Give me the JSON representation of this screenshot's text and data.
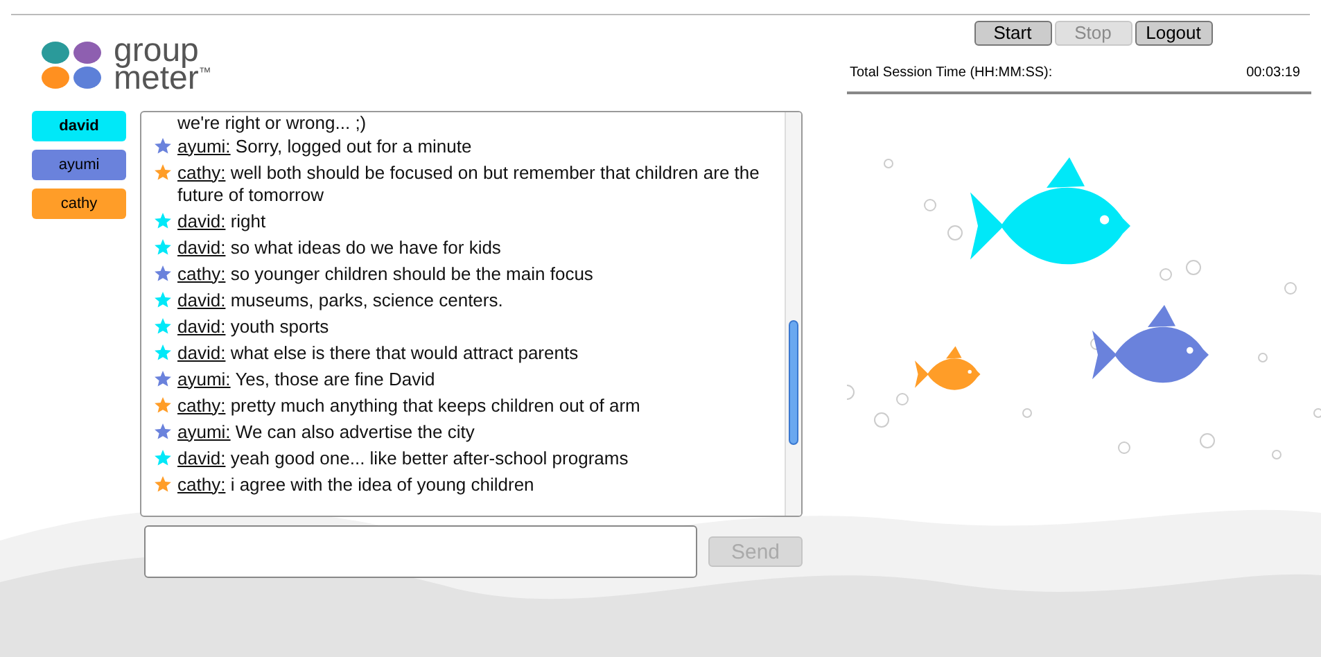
{
  "logo": {
    "line1": "group",
    "line2": "meter",
    "mark": "™"
  },
  "users": [
    {
      "name": "david",
      "color": "#00e8f8",
      "selected": true
    },
    {
      "name": "ayumi",
      "color": "#6a82dc",
      "selected": false
    },
    {
      "name": "cathy",
      "color": "#ff9d28",
      "selected": false
    }
  ],
  "messages": [
    {
      "kind": "continuation",
      "text": "we're right or wrong... ;)"
    },
    {
      "kind": "message",
      "user": "ayumi:",
      "color": "#6a82dc",
      "text": "Sorry, logged out for a minute"
    },
    {
      "kind": "message",
      "user": "cathy:",
      "color": "#ff9d28",
      "text": "well both should be focused on but remember that children are the future of tomorrow"
    },
    {
      "kind": "message",
      "user": "david:",
      "color": "#00e8f8",
      "text": "right"
    },
    {
      "kind": "message",
      "user": "david:",
      "color": "#00e8f8",
      "text": "so what ideas do we have for kids"
    },
    {
      "kind": "message",
      "user": "cathy:",
      "color": "#6a82dc",
      "text": "so younger children should be the main focus"
    },
    {
      "kind": "message",
      "user": "david:",
      "color": "#00e8f8",
      "text": "museums, parks, science centers."
    },
    {
      "kind": "message",
      "user": "david:",
      "color": "#00e8f8",
      "text": "youth sports"
    },
    {
      "kind": "message",
      "user": "david:",
      "color": "#00e8f8",
      "text": "what else is there that would attract parents"
    },
    {
      "kind": "message",
      "user": "ayumi:",
      "color": "#6a82dc",
      "text": "Yes, those are fine David"
    },
    {
      "kind": "message",
      "user": "cathy:",
      "color": "#ff9d28",
      "text": "pretty much anything that keeps children out of arm"
    },
    {
      "kind": "message",
      "user": "ayumi:",
      "color": "#6a82dc",
      "text": "We can also advertise the city"
    },
    {
      "kind": "message",
      "user": "david:",
      "color": "#00e8f8",
      "text": "yeah good one... like better after-school programs"
    },
    {
      "kind": "message",
      "user": "cathy:",
      "color": "#ff9d28",
      "text": "i agree with the idea of young children"
    }
  ],
  "send_button": {
    "label": "Send",
    "disabled": true
  },
  "controls": [
    {
      "label": "Start",
      "disabled": false
    },
    {
      "label": "Stop",
      "disabled": true
    },
    {
      "label": "Logout",
      "disabled": false
    }
  ],
  "session": {
    "label": "Total Session Time (HH:MM:SS):",
    "value": "00:03:19"
  }
}
